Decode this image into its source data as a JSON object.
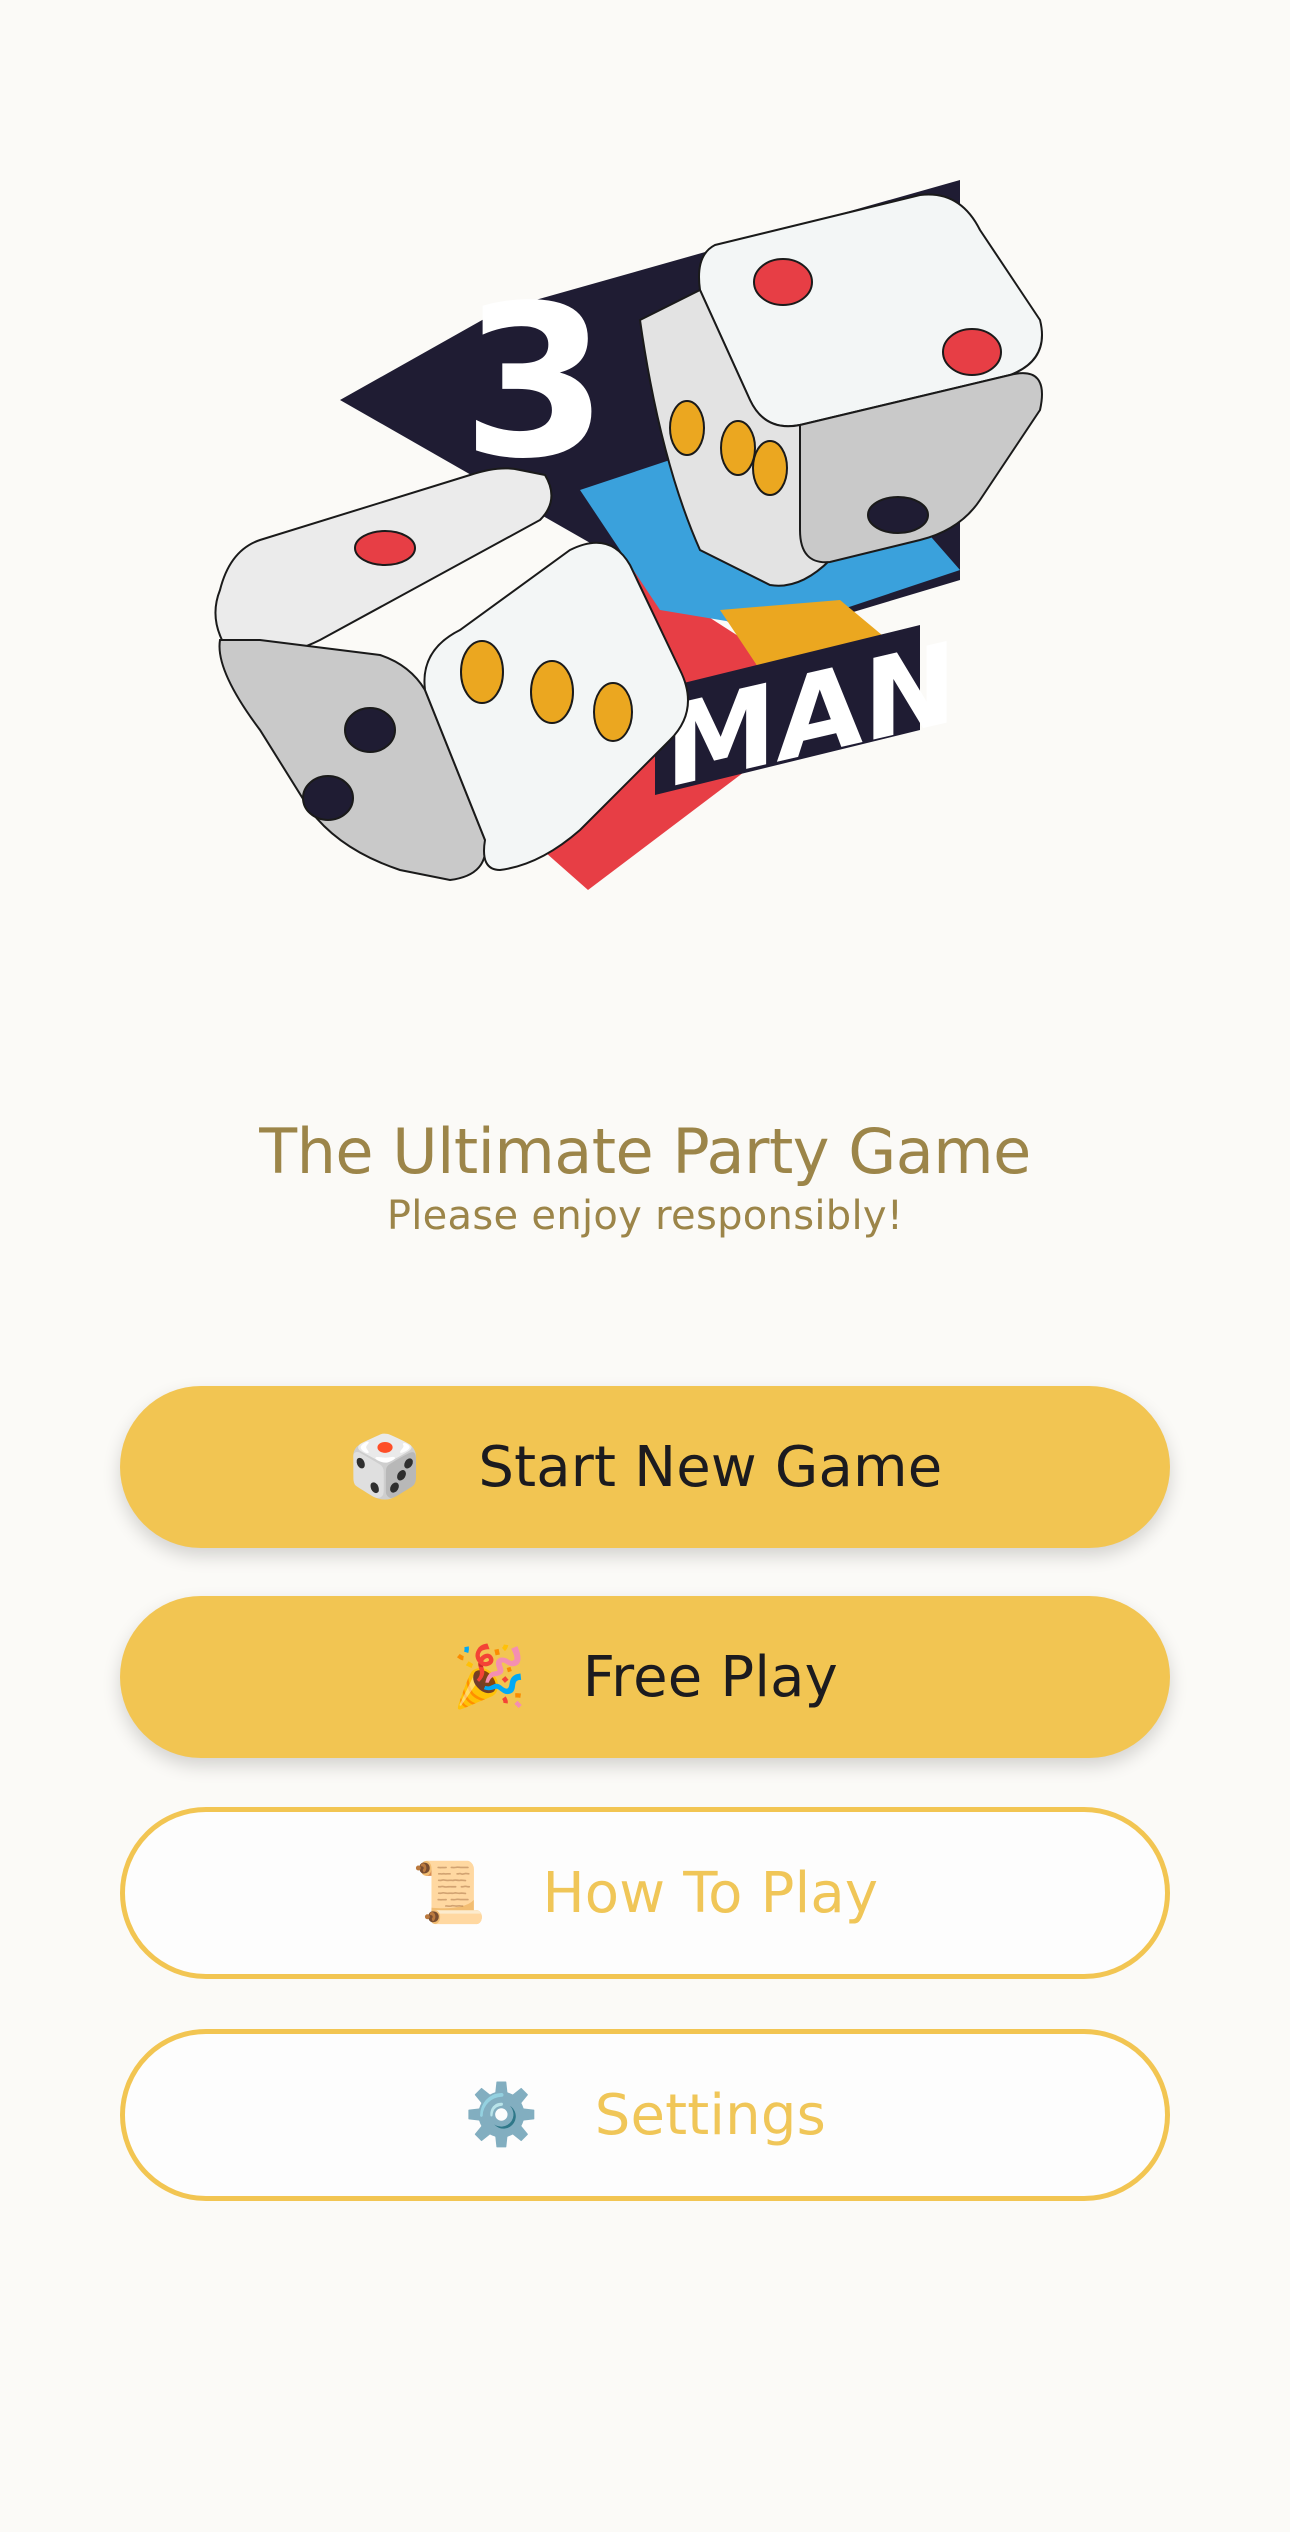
{
  "logo": {
    "number": "3",
    "word": "MAN",
    "colors": {
      "navy": "#1f1c33",
      "blue": "#3aa1dc",
      "red": "#e73e45",
      "yellow": "#eba720",
      "die_face": "#f3f6f6",
      "die_side": "#c9c9c9"
    }
  },
  "tagline": {
    "title": "The Ultimate Party Game",
    "subtitle": "Please enjoy responsibly!"
  },
  "menu": {
    "start": {
      "icon": "🎲",
      "label": "Start New Game"
    },
    "free": {
      "icon": "🎉",
      "label": "Free Play"
    },
    "how": {
      "icon": "📜",
      "label": "How To Play"
    },
    "settings": {
      "icon": "⚙️",
      "label": "Settings"
    }
  },
  "theme": {
    "accent": "#f2c552",
    "background": "#fbfaf7",
    "tagline_color": "#9c8549"
  }
}
